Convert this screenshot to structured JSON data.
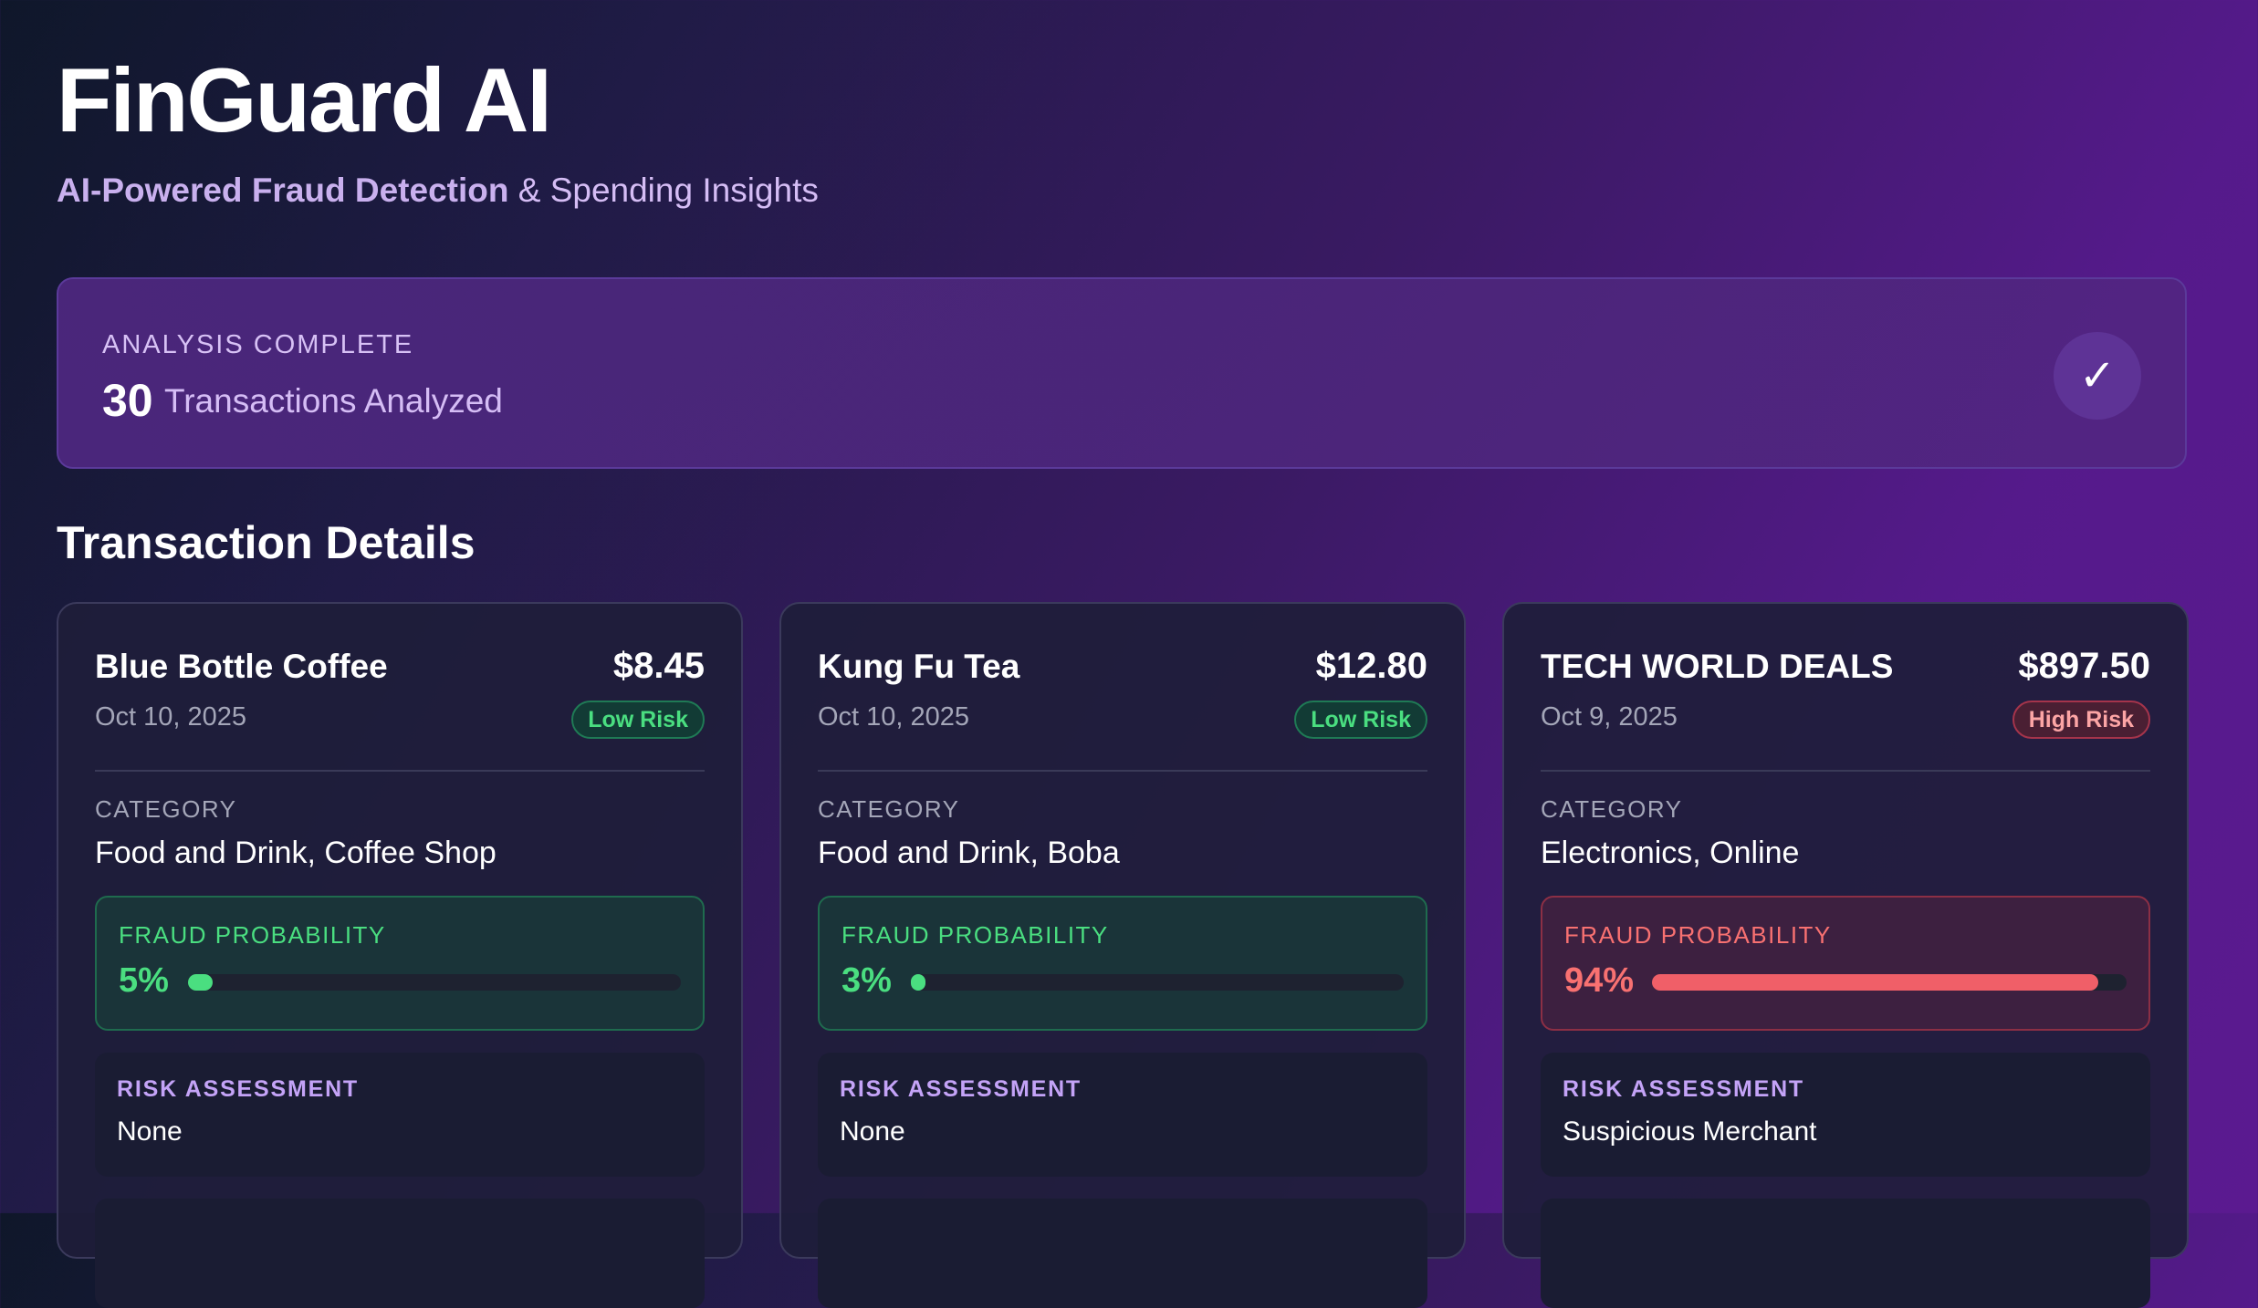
{
  "header": {
    "title": "FinGuard AI",
    "subtitle_bold": "AI-Powered Fraud Detection",
    "subtitle_rest": "& Spending Insights"
  },
  "summary": {
    "label": "ANALYSIS COMPLETE",
    "count": "30",
    "text": "Transactions Analyzed",
    "check_icon": "✓"
  },
  "section_title": "Transaction Details",
  "cards": [
    {
      "merchant": "Blue Bottle Coffee",
      "amount": "$8.45",
      "date": "Oct 10, 2025",
      "risk_badge": "Low Risk",
      "risk_level": "low",
      "category_label": "CATEGORY",
      "category": "Food and Drink, Coffee Shop",
      "fraud_label": "FRAUD PROBABILITY",
      "fraud_pct_text": "5%",
      "fraud_fraction": 0.05,
      "risk_assessment_label": "RISK ASSESSMENT",
      "risk_assessment": "None"
    },
    {
      "merchant": "Kung Fu Tea",
      "amount": "$12.80",
      "date": "Oct 10, 2025",
      "risk_badge": "Low Risk",
      "risk_level": "low",
      "category_label": "CATEGORY",
      "category": "Food and Drink, Boba",
      "fraud_label": "FRAUD PROBABILITY",
      "fraud_pct_text": "3%",
      "fraud_fraction": 0.03,
      "risk_assessment_label": "RISK ASSESSMENT",
      "risk_assessment": "None"
    },
    {
      "merchant": "TECH WORLD DEALS",
      "amount": "$897.50",
      "date": "Oct 9, 2025",
      "risk_badge": "High Risk",
      "risk_level": "high",
      "category_label": "CATEGORY",
      "category": "Electronics, Online",
      "fraud_label": "FRAUD PROBABILITY",
      "fraud_pct_text": "94%",
      "fraud_fraction": 0.94,
      "risk_assessment_label": "RISK ASSESSMENT",
      "risk_assessment": "Suspicious Merchant"
    }
  ],
  "colors": {
    "low_risk": "#4ade80",
    "high_risk": "#f87171",
    "accent": "#c4a3f7"
  }
}
